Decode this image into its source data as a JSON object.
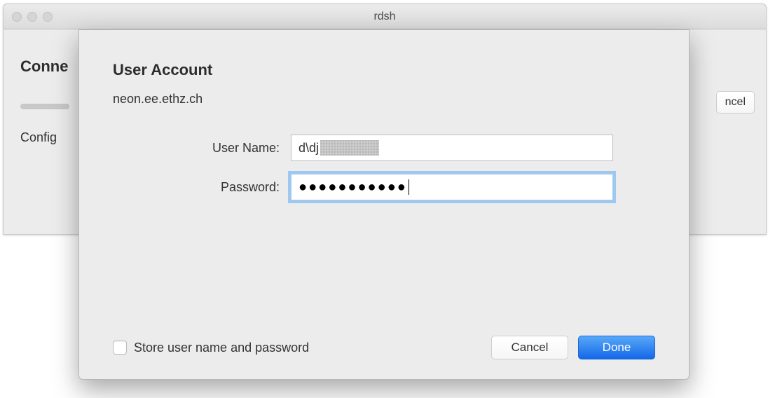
{
  "window": {
    "title": "rdsh"
  },
  "background": {
    "heading_partial": "Conne",
    "config_partial": "Config",
    "cancel_partial": "ncel"
  },
  "modal": {
    "title": "User Account",
    "host": "neon.ee.ethz.ch",
    "username_label": "User Name:",
    "password_label": "Password:",
    "username_value_visible": "d\\dj",
    "password_value": "●●●●●●●●●●●",
    "store_label": "Store user name and password",
    "store_checked": false,
    "cancel_label": "Cancel",
    "done_label": "Done"
  }
}
